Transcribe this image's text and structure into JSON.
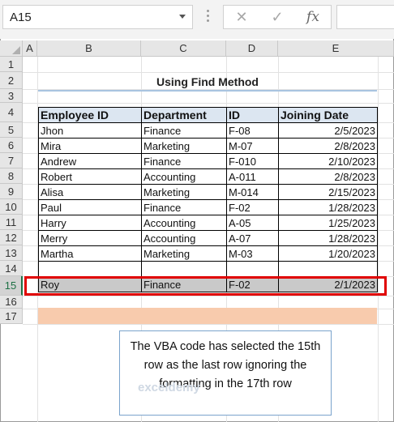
{
  "formula_bar": {
    "name_box": "A15",
    "cancel_icon": "close-icon",
    "enter_icon": "check-icon",
    "function_label": "fx",
    "formula_value": ""
  },
  "columns": [
    "A",
    "B",
    "C",
    "D",
    "E"
  ],
  "rows": [
    "1",
    "2",
    "3",
    "4",
    "5",
    "6",
    "7",
    "8",
    "9",
    "10",
    "11",
    "12",
    "13",
    "14",
    "15",
    "16",
    "17"
  ],
  "title": "Using Find Method",
  "table": {
    "headers": [
      "Employee ID",
      "Department",
      "ID",
      "Joining Date"
    ],
    "rows": [
      [
        "Jhon",
        "Finance",
        "F-08",
        "2/5/2023"
      ],
      [
        "Mira",
        "Marketing",
        "M-07",
        "2/8/2023"
      ],
      [
        "Andrew",
        "Finance",
        "F-010",
        "2/10/2023"
      ],
      [
        "Robert",
        "Accounting",
        "A-011",
        "2/8/2023"
      ],
      [
        "Alisa",
        "Marketing",
        "M-014",
        "2/15/2023"
      ],
      [
        "Paul",
        "Finance",
        "F-02",
        "1/28/2023"
      ],
      [
        "Harry",
        "Accounting",
        "A-05",
        "1/25/2023"
      ],
      [
        "Merry",
        "Accounting",
        "A-07",
        "1/28/2023"
      ],
      [
        "Martha",
        "Marketing",
        "M-03",
        "1/20/2023"
      ]
    ],
    "selected_row": [
      "Roy",
      "Finance",
      "F-02",
      "2/1/2023"
    ]
  },
  "note": "The VBA code has selected the 15th row as the last row ignoring the formatting in the 17th row",
  "watermark": "exceldemy",
  "colors": {
    "header_fill": "#dce6f1",
    "selected_fill": "#c9c9c9",
    "highlight_border": "#e00000",
    "orange_fill": "#f8cbad",
    "accent_green": "#1e7145"
  }
}
